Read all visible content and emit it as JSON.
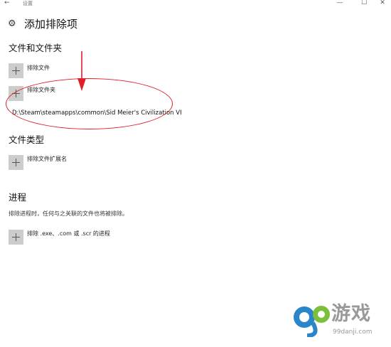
{
  "window": {
    "title": "设置",
    "back": "←",
    "minimize": "—",
    "maximize": "☐",
    "close": "✕"
  },
  "page": {
    "title": "添加排除项",
    "icon": "gear-icon"
  },
  "sections": {
    "files": {
      "title": "文件和文件夹",
      "exclude_file": "排除文件",
      "exclude_folder": "排除文件夹",
      "excluded_path": "D:\\Steam\\steamapps\\common\\Sid Meier's Civilization VI"
    },
    "types": {
      "title": "文件类型",
      "exclude_ext": "排除文件扩展名"
    },
    "processes": {
      "title": "进程",
      "description": "排除进程时，任何与之关联的文件也将被排除。",
      "exclude_process": "排除 .exe、.com 或 .scr 的进程"
    }
  },
  "watermark": {
    "brand": "游戏",
    "domain": "99danji.com"
  },
  "colors": {
    "annotation": "#e0202a",
    "button_bg": "#cccccc",
    "watermark_blue": "#2a86c8",
    "watermark_green": "#7bbf3a"
  }
}
